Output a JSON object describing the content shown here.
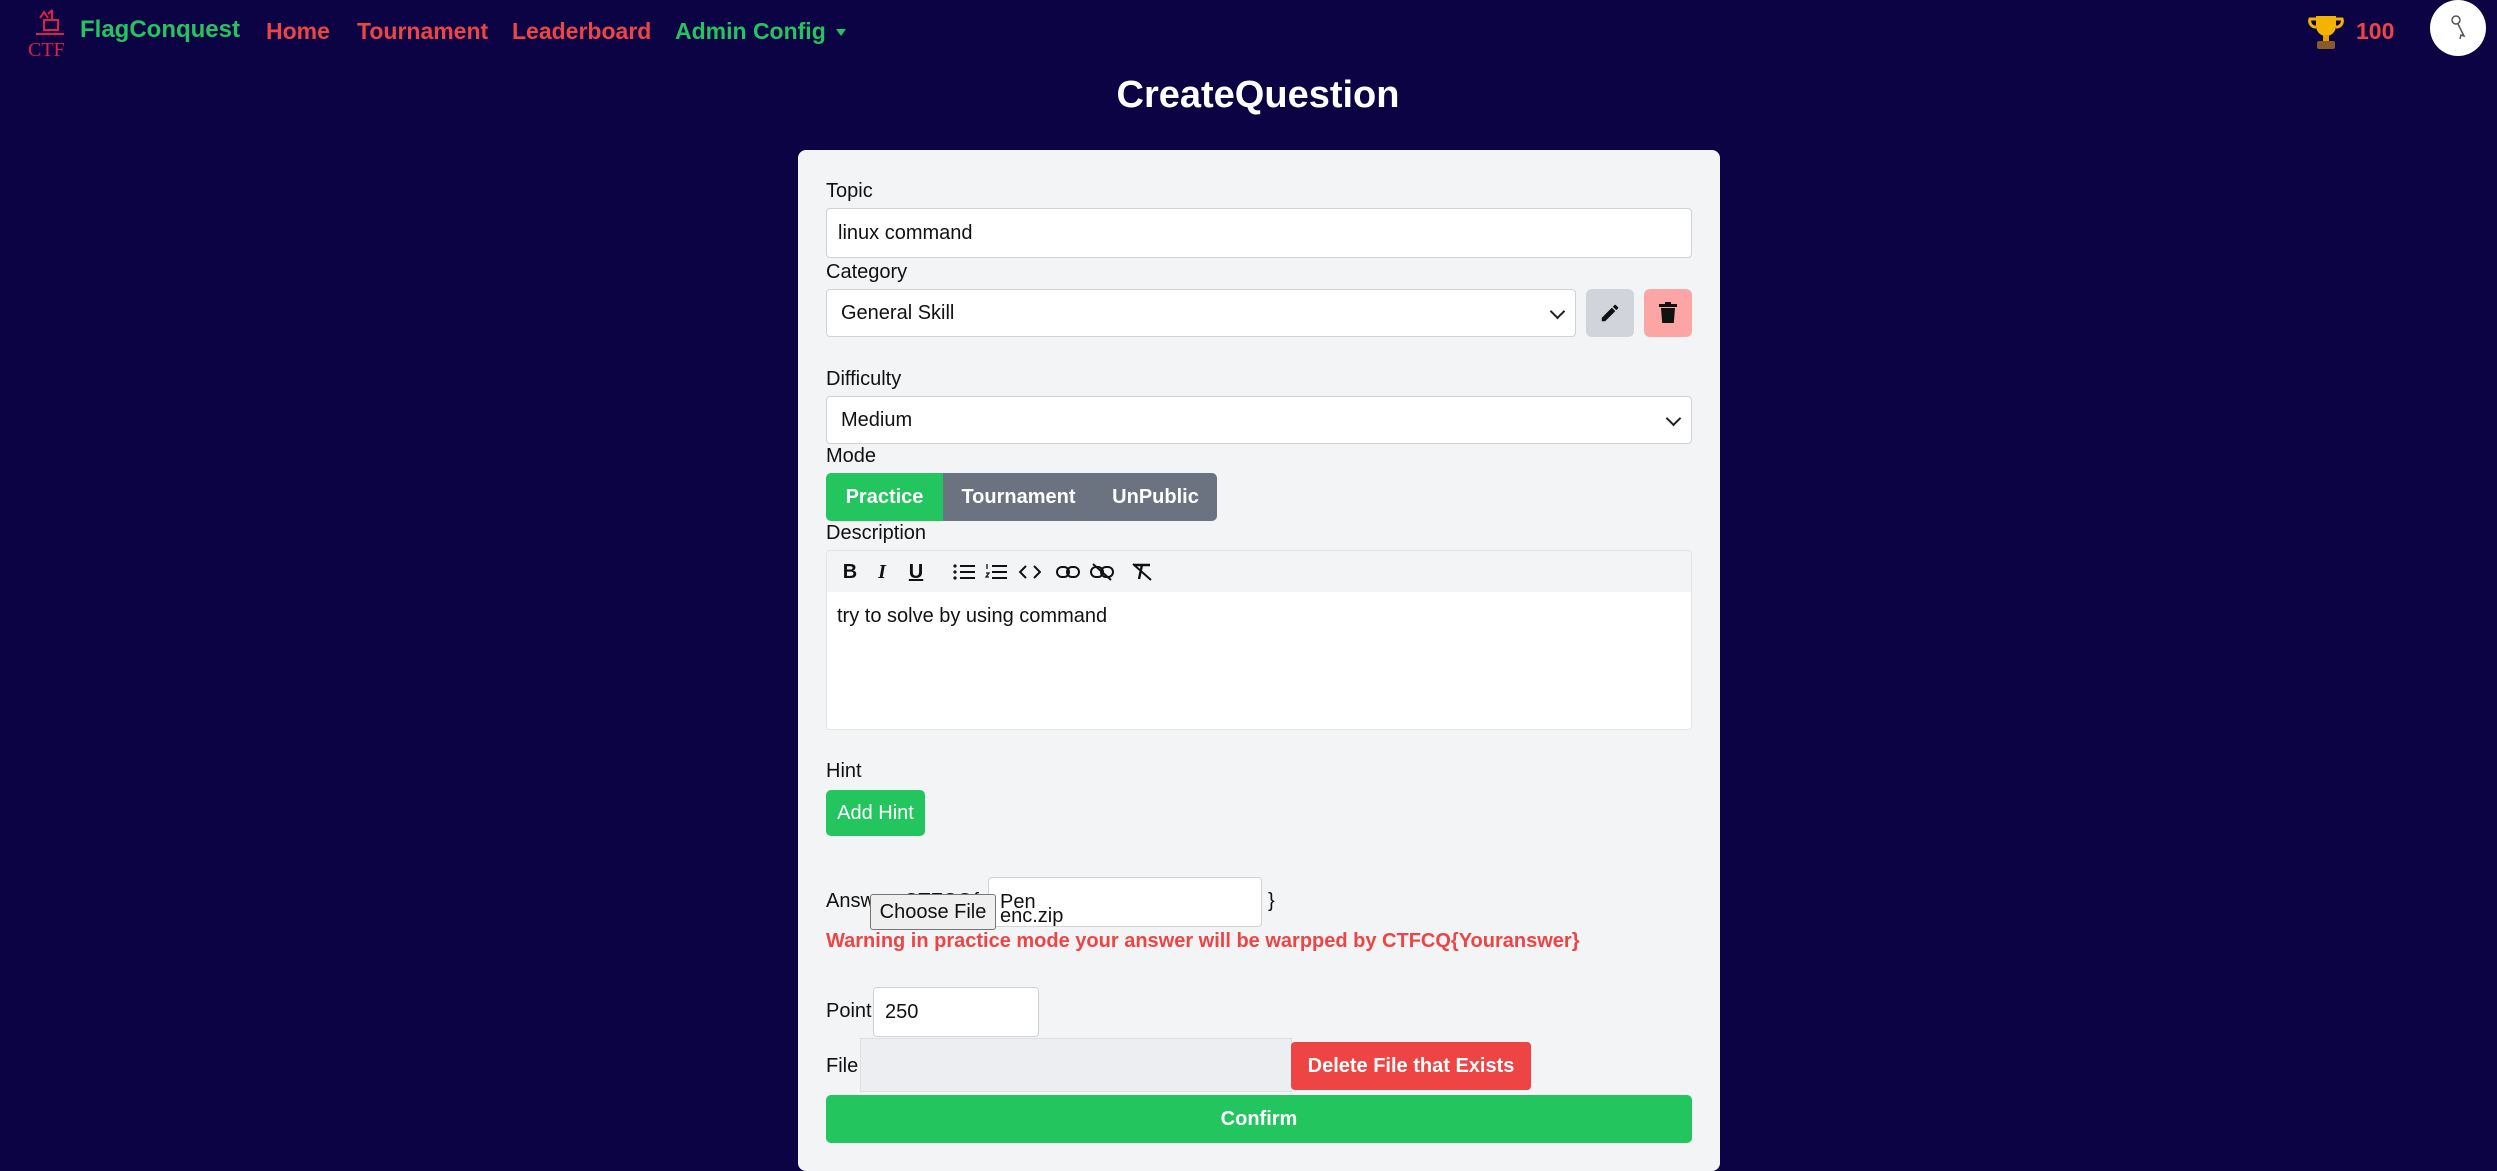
{
  "nav": {
    "logo_text": "CTF",
    "brand": "FlagConquest",
    "links": [
      "Home",
      "Tournament",
      "Leaderboard"
    ],
    "admin_label": "Admin Config",
    "points": "100"
  },
  "page": {
    "title": "CreateQuestion"
  },
  "form": {
    "topic_label": "Topic",
    "topic_value": "linux command",
    "category_label": "Category",
    "category_value": "General Skill",
    "difficulty_label": "Difficulty",
    "difficulty_value": "Medium",
    "mode_label": "Mode",
    "modes": [
      "Practice",
      "Tournament",
      "UnPublic"
    ],
    "selected_mode": "Practice",
    "description_label": "Description",
    "description_text": "try to solve by using command",
    "hint_label": "Hint",
    "add_hint_label": "Add Hint",
    "answer_prefix": "Answer: CTFCQ{",
    "answer_value": "Pen",
    "answer_suffix": "}",
    "warning": "Warning in practice mode your answer will be warpped by CTFCQ{Youranswer}",
    "point_label": "Point",
    "point_value": "250",
    "file_label": "File",
    "choose_file_label": "Choose File",
    "file_name": "enc.zip",
    "delete_file_label": "Delete File that Exists",
    "confirm_label": "Confirm"
  },
  "colors": {
    "background": "#0b0344",
    "green": "#22c55e",
    "red": "#ef4444",
    "gray": "#6b7280",
    "card": "#f3f4f6"
  },
  "icons": [
    "ctf-logo-icon",
    "chevron-down-icon",
    "trophy-icon",
    "avatar-icon",
    "pencil-icon",
    "trash-icon",
    "bold-icon",
    "italic-icon",
    "underline-icon",
    "bullet-list-icon",
    "numbered-list-icon",
    "code-icon",
    "link-icon",
    "unlink-icon",
    "clear-format-icon"
  ]
}
